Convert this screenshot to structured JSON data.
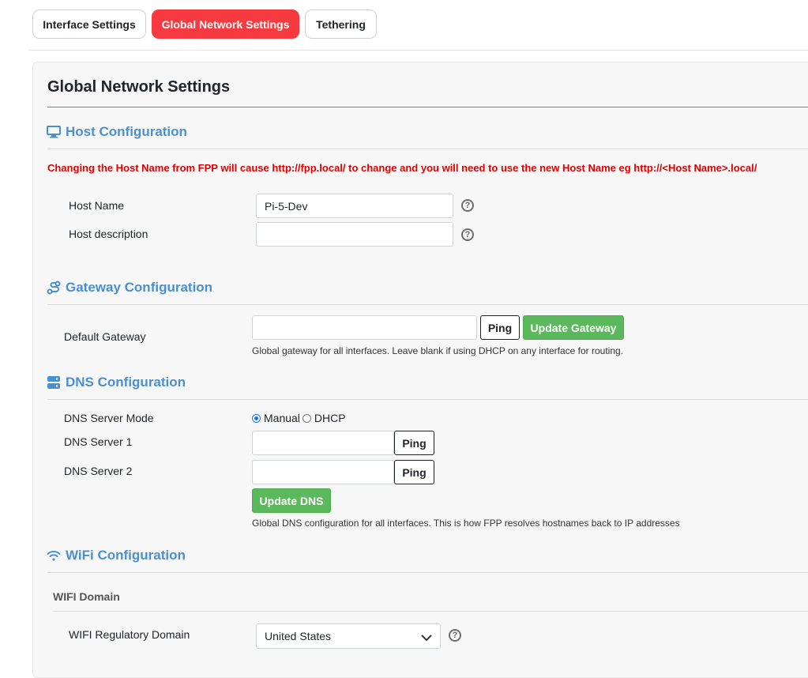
{
  "tabs": [
    {
      "label": "Interface Settings",
      "active": false
    },
    {
      "label": "Global Network Settings",
      "active": true
    },
    {
      "label": "Tethering",
      "active": false
    }
  ],
  "page_title": "Global Network Settings",
  "host": {
    "heading": "Host Configuration",
    "icon": "monitor-icon",
    "warning": "Changing the Host Name from FPP will cause http://fpp.local/ to change and you will need to use the new Host Name eg http://<Host Name>.local/",
    "host_name_label": "Host Name",
    "host_name_value": "Pi-5-Dev",
    "host_desc_label": "Host description",
    "host_desc_value": ""
  },
  "gateway": {
    "heading": "Gateway Configuration",
    "icon": "route-icon",
    "label": "Default Gateway",
    "value": "",
    "ping_label": "Ping",
    "update_label": "Update Gateway",
    "hint": "Global gateway for all interfaces. Leave blank if using DHCP on any interface for routing."
  },
  "dns": {
    "heading": "DNS Configuration",
    "icon": "server-icon",
    "mode_label": "DNS Server Mode",
    "mode_options": [
      "Manual",
      "DHCP"
    ],
    "mode_selected": "Manual",
    "server1_label": "DNS Server 1",
    "server1_value": "",
    "server2_label": "DNS Server 2",
    "server2_value": "",
    "ping_label": "Ping",
    "update_label": "Update DNS",
    "hint": "Global DNS configuration for all interfaces. This is how FPP resolves hostnames back to IP addresses"
  },
  "wifi": {
    "heading": "WiFi Configuration",
    "icon": "wifi-icon",
    "subheading": "WIFI Domain",
    "domain_label": "WIFI Regulatory Domain",
    "domain_value": "United States"
  },
  "help_glyph": "?",
  "colors": {
    "active_tab": "#f73a3f",
    "section_heading": "#4a90d1",
    "warning": "#e00000",
    "success_button": "#5cb85c"
  }
}
